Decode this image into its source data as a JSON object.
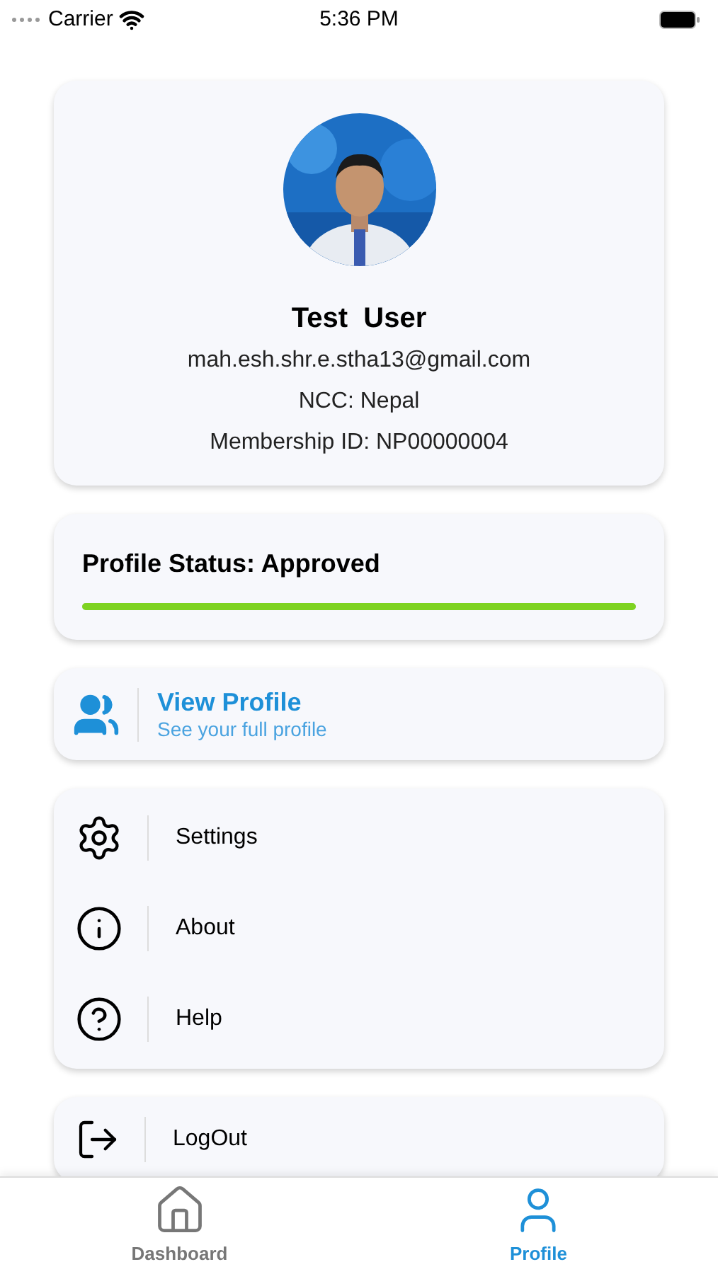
{
  "status_bar": {
    "carrier": "Carrier",
    "time": "5:36 PM"
  },
  "profile": {
    "name": "Test  User",
    "email": "mah.esh.shr.e.stha13@gmail.com",
    "ncc": "NCC: Nepal",
    "membership": "Membership ID: NP00000004"
  },
  "profile_status": {
    "label": "Profile Status: Approved",
    "level": 1
  },
  "view_profile": {
    "title": "View Profile",
    "subtitle": "See your full profile"
  },
  "menu": [
    {
      "kind": "settings",
      "label": "Settings"
    },
    {
      "kind": "about",
      "label": "About"
    },
    {
      "kind": "help",
      "label": "Help"
    }
  ],
  "logout": {
    "label": "LogOut"
  },
  "tabs": [
    {
      "kind": "home",
      "label": "Dashboard",
      "selected": false
    },
    {
      "kind": "person",
      "label": "Profile",
      "selected": true
    }
  ]
}
